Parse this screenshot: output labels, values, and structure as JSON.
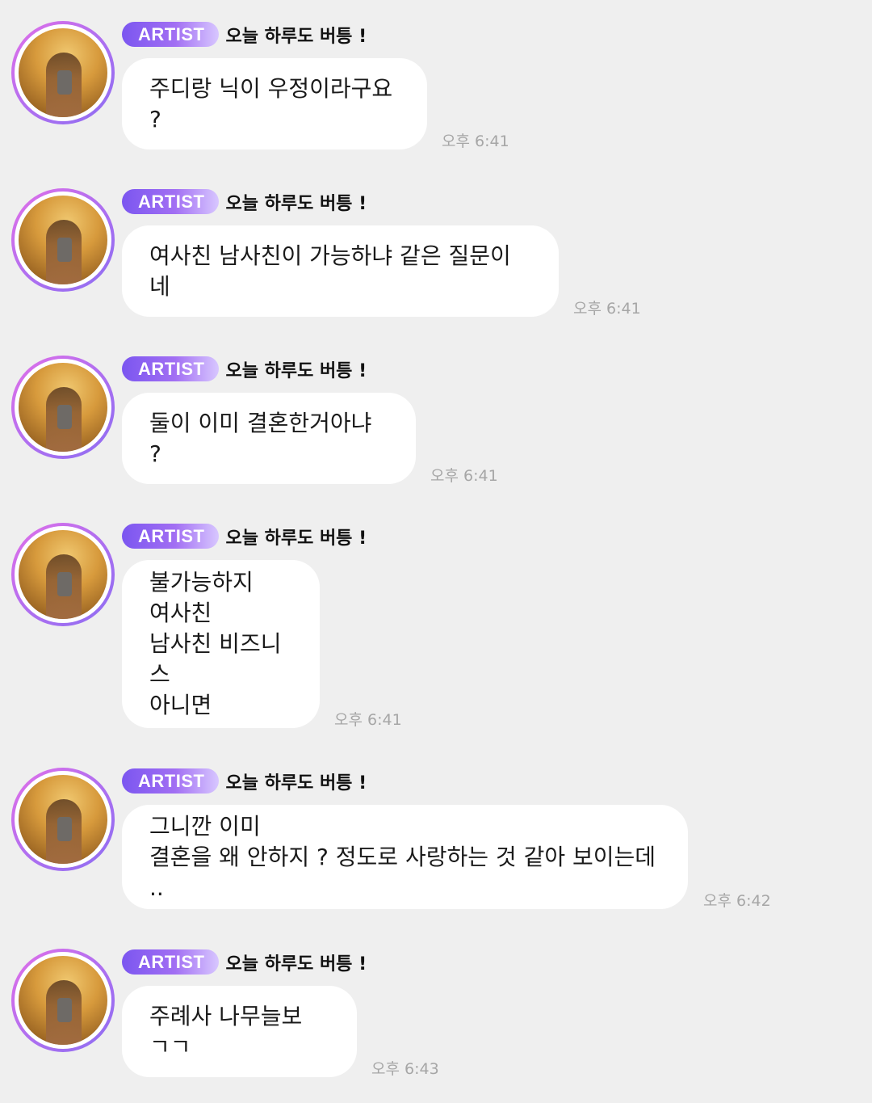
{
  "chat": {
    "messages": [
      {
        "badge": "ARTIST",
        "nickname": "오늘 하루도 버틍 !",
        "text": "주디랑 닉이 우정이라구요 ?",
        "time": "오후 6:41"
      },
      {
        "badge": "ARTIST",
        "nickname": "오늘 하루도 버틍 !",
        "text": "여사친 남사친이 가능하냐 같은 질문이네",
        "time": "오후 6:41"
      },
      {
        "badge": "ARTIST",
        "nickname": "오늘 하루도 버틍 !",
        "text": "둘이 이미 결혼한거아냐 ?",
        "time": "오후 6:41"
      },
      {
        "badge": "ARTIST",
        "nickname": "오늘 하루도 버틍 !",
        "text": "불가능하지\n여사친\n남사친 비즈니스\n아니면",
        "time": "오후 6:41"
      },
      {
        "badge": "ARTIST",
        "nickname": "오늘 하루도 버틍 !",
        "text": "그니깐 이미\n결혼을 왜 안하지 ? 정도로 사랑하는 것 같아 보이는데 ..",
        "time": "오후 6:42"
      },
      {
        "badge": "ARTIST",
        "nickname": "오늘 하루도 버틍 !",
        "text": "주례사 나무늘보 ㄱㄱ",
        "time": "오후 6:43"
      }
    ]
  },
  "colors": {
    "background": "#efefef",
    "bubble": "#ffffff",
    "badge_start": "#7b56f0",
    "badge_end": "#d8c7ff",
    "avatar_ring": "#b06ff0",
    "time_text": "#a6a6a6"
  },
  "icons": {
    "avatar": "artist-profile-photo"
  }
}
